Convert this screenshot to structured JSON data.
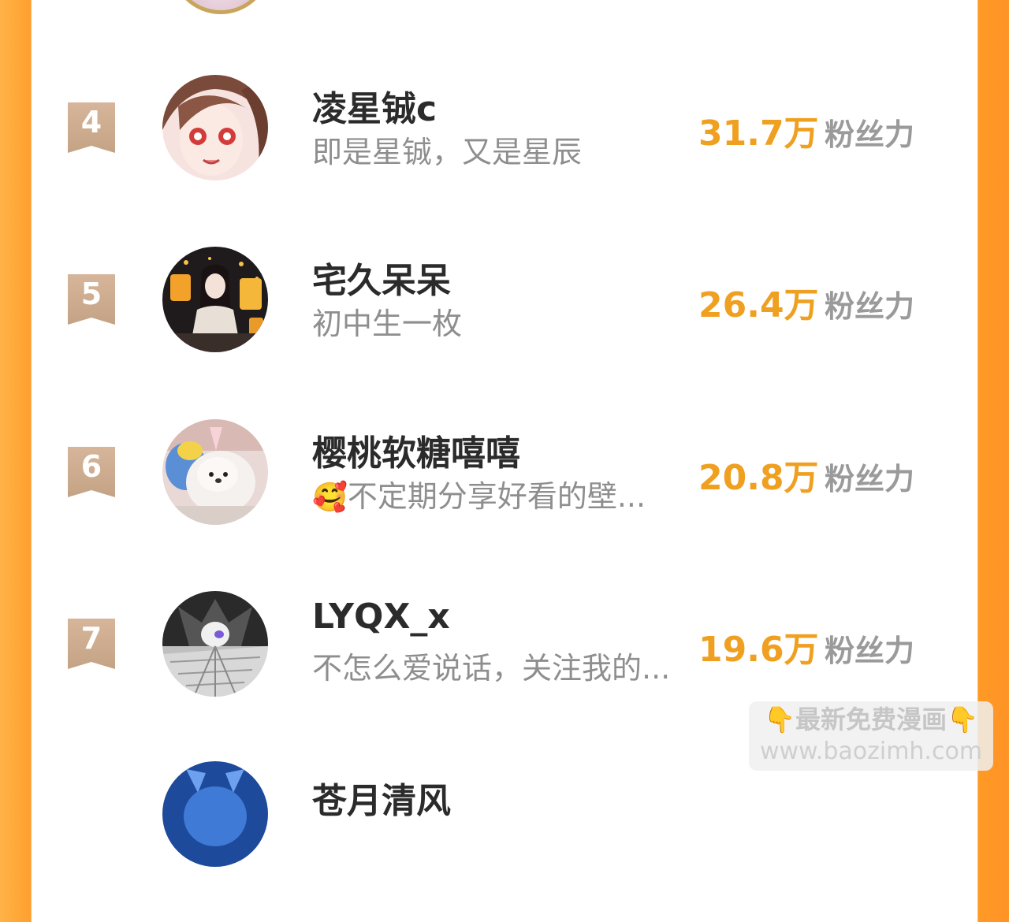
{
  "leaderboard": {
    "entries": [
      {
        "rank": "4",
        "name": "凌星铖c",
        "bio": "即是星铖，又是星辰",
        "bio_emoji": "",
        "fans_value": "31.7万",
        "fans_label": "粉丝力"
      },
      {
        "rank": "5",
        "name": "宅久呆呆",
        "bio": "初中生一枚",
        "bio_emoji": "",
        "fans_value": "26.4万",
        "fans_label": "粉丝力"
      },
      {
        "rank": "6",
        "name": "樱桃软糖嘻嘻",
        "bio": "不定期分享好看的壁...",
        "bio_emoji": "🥰",
        "fans_value": "20.8万",
        "fans_label": "粉丝力"
      },
      {
        "rank": "7",
        "name": "LYQX_x",
        "bio": "不怎么爱说话，关注我的...",
        "bio_emoji": "",
        "fans_value": "19.6万",
        "fans_label": "粉丝力"
      }
    ],
    "partial_next_name": "苍月清风"
  },
  "watermark": {
    "line1": "👇最新免费漫画👇",
    "line2": "www.baozimh.com"
  },
  "colors": {
    "accent": "#f0a020",
    "frame": "#ff9f2e",
    "rank_ribbon": "#d6b59a",
    "name": "#2b2b2b",
    "bio": "#8e8e8e"
  }
}
